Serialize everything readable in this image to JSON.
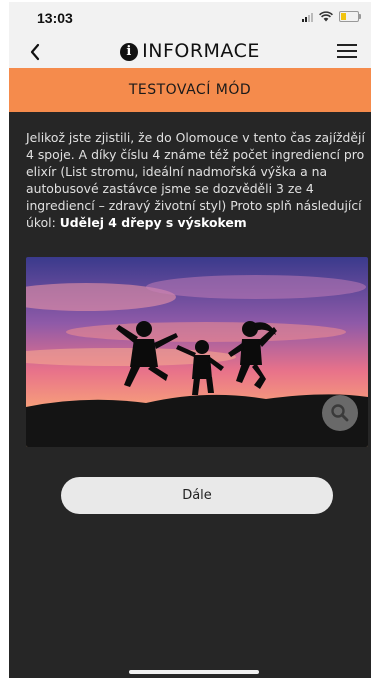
{
  "status_bar": {
    "time": "13:03"
  },
  "nav": {
    "title": "INFORMACE"
  },
  "banner": {
    "label": "TESTOVACÍ MÓD"
  },
  "content": {
    "paragraph": "Jelikož jste zjistili, že do Olomouce v tento čas zajíždějí 4 spoje. A díky číslu 4 známe též počet ingrediencí pro elixír (List stromu, ideální nadmořská výška a na autobusové zastávce jsme se dozvěděli 3 ze 4 ingrediencí – zdravý životní styl) Proto splň následující úkol: ",
    "task": "Udělej 4 dřepy s výskokem"
  },
  "buttons": {
    "next": "Dále"
  },
  "colors": {
    "accent": "#f58b4c",
    "background": "#262626"
  },
  "icons": {
    "back": "chevron-left-icon",
    "info": "info-icon",
    "menu": "hamburger-icon",
    "zoom": "magnifier-icon"
  }
}
